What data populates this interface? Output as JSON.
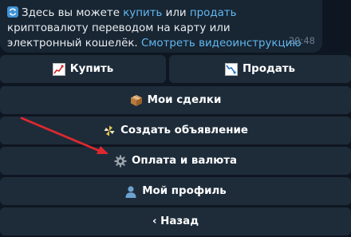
{
  "message": {
    "sync_icon": "counterclockwise-arrows-emoji",
    "text_part1": "Здесь вы можете ",
    "link_buy": "купить",
    "text_part2": " или ",
    "link_sell": "продать",
    "text_part3": " криптовалюту переводом на карту или электронный кошелёк. ",
    "link_video": "Смотреть видеоинструкцию ›",
    "time": "20:48"
  },
  "keyboard": {
    "buy": {
      "label": "Купить",
      "icon": "chart-increasing-emoji"
    },
    "sell": {
      "label": "Продать",
      "icon": "chart-decreasing-emoji"
    },
    "my_deals": {
      "label": "Мои сделки",
      "icon": "package-emoji"
    },
    "create_ad": {
      "label": "Создать объявление",
      "icon": "pinwheel-emoji"
    },
    "payment_currency": {
      "label": "Оплата и валюта",
      "icon": "gear-emoji"
    },
    "my_profile": {
      "label": "Мой профиль",
      "icon": "bust-silhouette-emoji"
    },
    "back": {
      "label": "‹ Назад"
    }
  },
  "annotation": {
    "icon": "red-arrow",
    "color": "#e0282e"
  },
  "colors": {
    "background": "#0e1621",
    "bubble": "#182533",
    "button": "#1e2c3a",
    "link": "#62b8f0",
    "text": "#e9edf0",
    "time": "#6b7d8e"
  }
}
